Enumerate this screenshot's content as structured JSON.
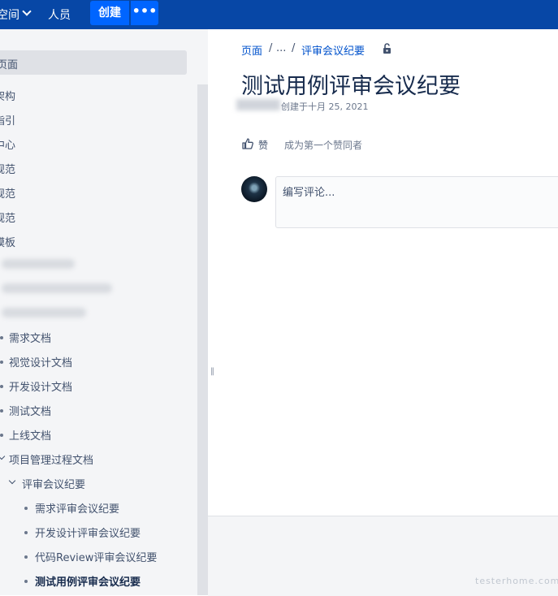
{
  "topbar": {
    "space_label": "空间",
    "people_label": "人员",
    "create_label": "创建",
    "more_label": "•••"
  },
  "sidebar": {
    "items": [
      {
        "label": "页面"
      },
      {
        "label": "架构"
      },
      {
        "label": "指引"
      },
      {
        "label": "中心"
      },
      {
        "label": "规范"
      },
      {
        "label": "规范"
      },
      {
        "label": "规范"
      },
      {
        "label": "模板"
      }
    ],
    "tree": [
      {
        "label": "需求文档"
      },
      {
        "label": "视觉设计文档"
      },
      {
        "label": "开发设计文档"
      },
      {
        "label": "测试文档"
      },
      {
        "label": "上线文档"
      },
      {
        "label": "项目管理过程文档"
      },
      {
        "label": "评审会议纪要"
      },
      {
        "label": "需求评审会议纪要"
      },
      {
        "label": "开发设计评审会议纪要"
      },
      {
        "label": "代码Review评审会议纪要"
      },
      {
        "label": "测试用例评审会议纪要"
      }
    ]
  },
  "breadcrumb": {
    "root": "页面",
    "sep1": "/",
    "ellipsis": "...",
    "sep2": "/",
    "parent": "评审会议纪要"
  },
  "page": {
    "title": "测试用例评审会议纪要",
    "byline": "创建于十月 25, 2021",
    "like_label": "赞",
    "like_hint": "成为第一个赞同者",
    "comment_placeholder": "编写评论..."
  },
  "watermark": "testerhome.com"
}
